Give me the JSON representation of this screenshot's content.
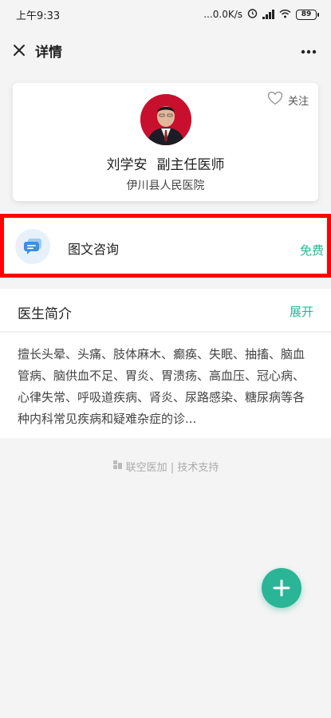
{
  "status_bar": {
    "time": "上午9:33",
    "network": "...0.0K/s",
    "battery": "89"
  },
  "nav": {
    "title": "详情"
  },
  "doctor": {
    "name": "刘学安",
    "title": "副主任医师",
    "hospital": "伊川县人民医院",
    "follow_label": "关注"
  },
  "consult": {
    "label": "图文咨询",
    "price": "免费"
  },
  "intro": {
    "title": "医生简介",
    "expand_label": "展开",
    "text": "擅长头晕、头痛、肢体麻木、癫痪、失眠、抽搐、脑血管病、脑供血不足、胃炎、胃溃疡、高血压、冠心病、心律失常、呼吸道疾病、肾炎、尿路感染、糖尿病等各种内科常见疾病和疑难杂症的诊..."
  },
  "footer": {
    "text": "联空医加 | 技术支持"
  },
  "colors": {
    "accent": "#2bb597",
    "highlight_border": "#ff0000",
    "avatar_bg": "#c8102e"
  }
}
